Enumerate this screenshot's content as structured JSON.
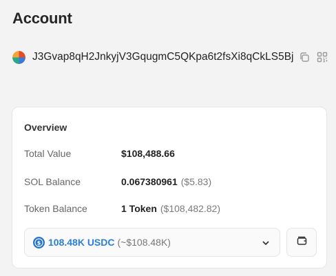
{
  "header": {
    "title": "Account"
  },
  "account": {
    "address": "J3Gvap8qH2JnkyjV3GqugmC5QKpa6t2fsXi8qCkLS5Bj"
  },
  "icons": {
    "avatar": "avatar-icon",
    "copy": "copy-icon",
    "qr": "qr-code-icon",
    "usdc": "usdc-icon",
    "chevron": "chevron-down-icon",
    "wallet": "wallet-icon"
  },
  "colors": {
    "accent": "#2b7fd6",
    "background": "#f3f3f4",
    "card": "#ffffff"
  },
  "overview": {
    "title": "Overview",
    "total_value": {
      "label": "Total Value",
      "value": "$108,488.66"
    },
    "sol_balance": {
      "label": "SOL Balance",
      "value": "0.067380961",
      "usd": "($5.83)"
    },
    "token_balance": {
      "label": "Token Balance",
      "value": "1 Token",
      "usd": "($108,482.82)"
    },
    "token_select": {
      "amount": "108.48K USDC",
      "usd": "(~$108.48K)"
    }
  }
}
